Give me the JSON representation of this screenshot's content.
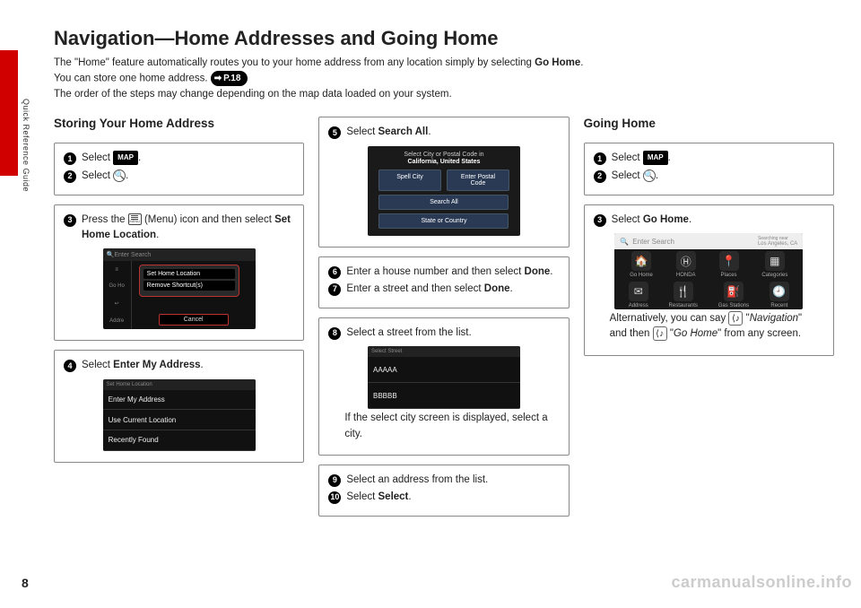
{
  "page_number": "8",
  "side_label": "Quick Reference Guide",
  "watermark": "carmanualsonline.info",
  "title": "Navigation—Home Addresses and Going Home",
  "intro_line1_a": "The \"Home\" feature automatically routes you to your home address from any location simply by selecting ",
  "intro_line1_b": "Go Home",
  "intro_line1_c": ".",
  "intro_line2": "You can store one home address. ",
  "pref": "P.18",
  "intro_line3": "The order of the steps may change depending on the map data loaded on your system.",
  "col1": {
    "heading": "Storing Your Home Address",
    "step1_a": "Select ",
    "map_label": "MAP",
    "step1_b": ".",
    "step2_a": "Select ",
    "step2_b": ".",
    "step3_a": "Press the ",
    "step3_b": " (Menu) icon and then select ",
    "step3_c": "Set Home Location",
    "step3_d": ".",
    "ss1": {
      "topbar": "Enter Search",
      "side1": "Go Ho",
      "side2": "Addre",
      "popup1": "Set Home Location",
      "popup2": "Remove Shortcut(s)",
      "cancel": "Cancel"
    },
    "step4_a": "Select ",
    "step4_b": "Enter My Address",
    "step4_c": ".",
    "ss2": {
      "topbar": "Set Home Location",
      "r1": "Enter My Address",
      "r2": "Use Current Location",
      "r3": "Recently Found"
    }
  },
  "col2": {
    "step5_a": "Select ",
    "step5_b": "Search All",
    "step5_c": ".",
    "ss3": {
      "hdr1": "Select City or Postal Code in",
      "hdr2": "California, United States",
      "b1": "Spell City",
      "b2": "Enter Postal Code",
      "b3": "Search All",
      "b4": "State or Country"
    },
    "step6_a": "Enter a house number and then select ",
    "step6_b": "Done",
    "step6_c": ".",
    "step7_a": "Enter a street and then select ",
    "step7_b": "Done",
    "step7_c": ".",
    "step8": "Select a street from the list.",
    "ss4": {
      "topbar": "Select Street",
      "r1": "AAAAA",
      "r2": "BBBBB"
    },
    "step8_note": "If the select city screen is displayed, select a city.",
    "step9": "Select an address from the list.",
    "step10_a": "Select ",
    "step10_b": "Select",
    "step10_c": "."
  },
  "col3": {
    "heading": "Going Home",
    "step1_a": "Select ",
    "step1_b": ".",
    "step2_a": "Select ",
    "step2_b": ".",
    "step3_a": "Select ",
    "step3_b": "Go Home",
    "step3_c": ".",
    "ss5": {
      "search_placeholder": "Enter Search",
      "city": "Los Angeles, CA",
      "i1": "Go Home",
      "i2": "HONDA",
      "i3": "Places",
      "i4": "Categories",
      "i5": "Address",
      "i6": "Restaurants",
      "i7": "Gas Stations",
      "i8": "Recent"
    },
    "note_a": "Alternatively, you can say ",
    "note_b": "\"",
    "note_c": "Navigation",
    "note_d": "\" and then ",
    "note_e": " \"",
    "note_f": "Go Home",
    "note_g": "\" from any screen."
  }
}
